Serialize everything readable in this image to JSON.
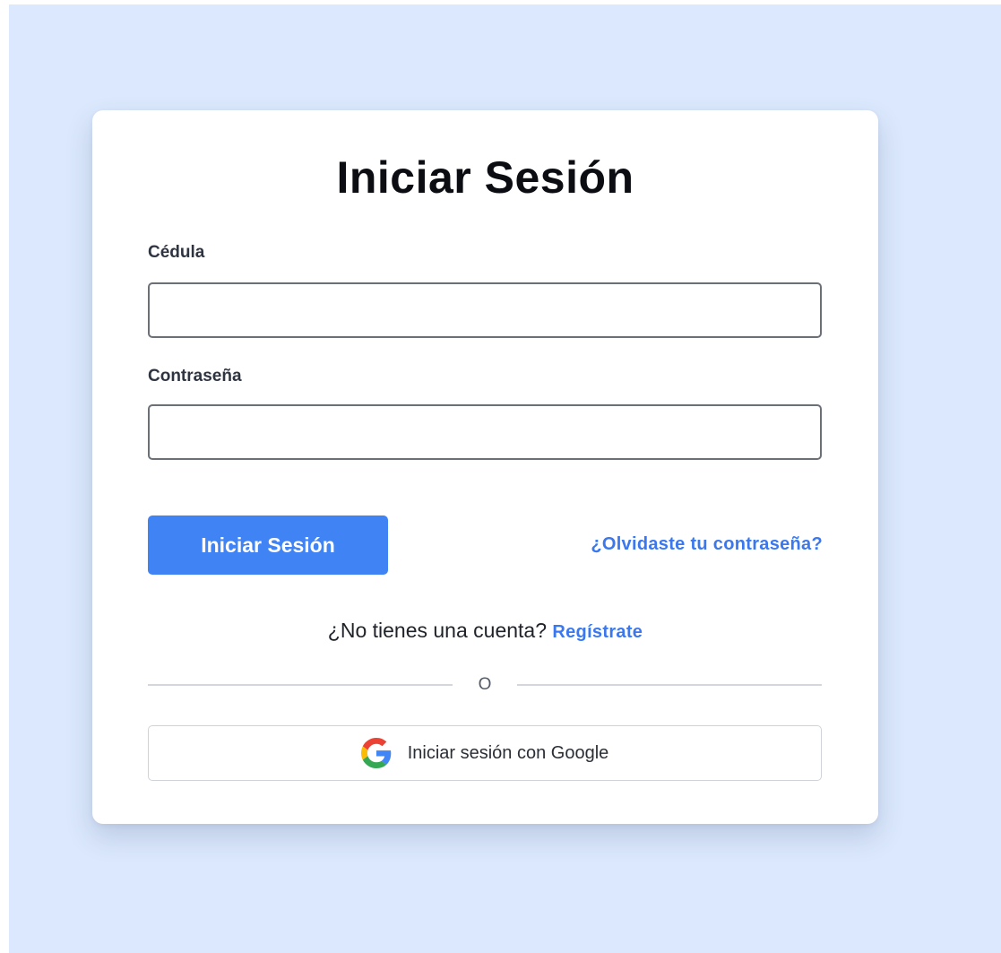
{
  "login": {
    "title": "Iniciar Sesión",
    "cedula_label": "Cédula",
    "cedula_value": "",
    "password_label": "Contraseña",
    "password_value": "",
    "submit_label": "Iniciar Sesión",
    "forgot_label": "¿Olvidaste tu contraseña?",
    "signup_prompt": "¿No tienes una cuenta?",
    "signup_link": "Regístrate",
    "divider_text": "O",
    "google_label": "Iniciar sesión con Google",
    "google_icon": "google-icon"
  },
  "colors": {
    "background": "#dbe8fd",
    "card": "#ffffff",
    "primary_button": "#3f83f4",
    "link": "#3b78ee",
    "title_text": "#0b0d12"
  }
}
